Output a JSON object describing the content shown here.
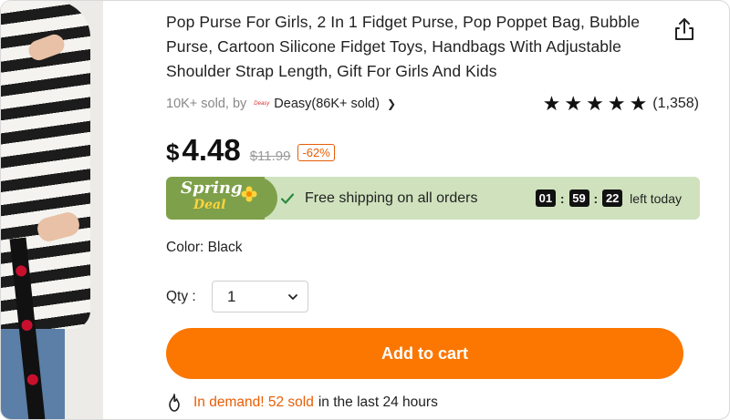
{
  "product": {
    "title": "Pop Purse For Girls, 2 In 1 Fidget Purse, Pop Poppet Bag, Bubble Purse, Cartoon Silicone Fidget Toys, Handbags With Adjustable Shoulder Strap Length, Gift For Girls And Kids",
    "sold_text": "10K+ sold, by",
    "store_logo": "Deasy",
    "store_name": "Deasy(86K+ sold)",
    "rating_stars": "★★★★★",
    "rating_value": 5,
    "review_count": "(1,358)",
    "currency": "$",
    "price": "4.48",
    "original_price": "$11.99",
    "discount": "-62%"
  },
  "promo": {
    "badge_line1": "Spring",
    "badge_line2": "Deal",
    "free_shipping": "Free shipping on all orders",
    "timer_hours": "01",
    "timer_minutes": "59",
    "timer_seconds": "22",
    "timer_suffix": "left today"
  },
  "options": {
    "color_label": "Color: Black",
    "qty_label": "Qty :",
    "qty_value": "1"
  },
  "actions": {
    "add_to_cart": "Add to cart"
  },
  "demand": {
    "highlight": "In demand! 52 sold",
    "rest": "in the last 24 hours"
  },
  "colors": {
    "accent": "#fb7701",
    "promo_bg": "#cfe2bd",
    "badge_green": "#7ea04a",
    "discount_orange": "#e85d04"
  },
  "icons": {
    "share": "share-icon",
    "check": "check-icon",
    "chevron": "chevron-down-icon",
    "flame": "flame-icon"
  }
}
